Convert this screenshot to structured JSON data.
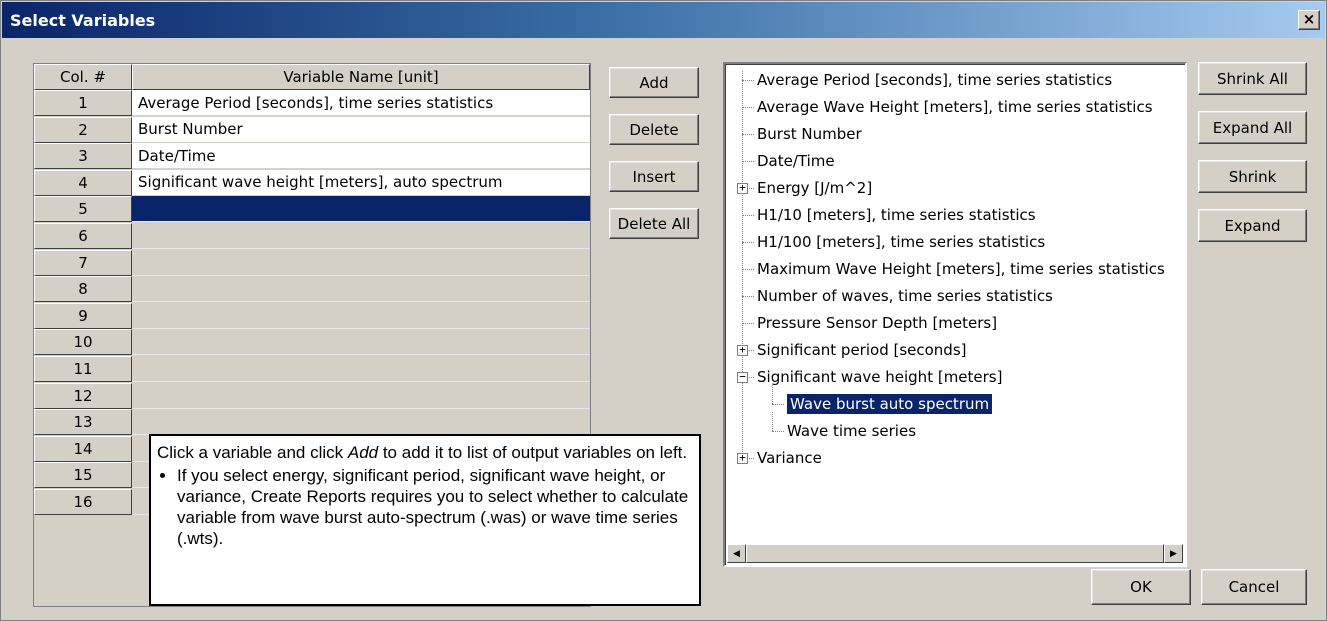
{
  "window": {
    "title": "Select Variables",
    "close_label": "×"
  },
  "grid": {
    "col_header": "Col. #",
    "name_header": "Variable Name [unit]",
    "rows": [
      {
        "num": "1",
        "name": "Average Period [seconds], time series statistics"
      },
      {
        "num": "2",
        "name": "Burst Number"
      },
      {
        "num": "3",
        "name": "Date/Time"
      },
      {
        "num": "4",
        "name": "Significant wave height [meters], auto spectrum"
      },
      {
        "num": "5",
        "name": ""
      },
      {
        "num": "6",
        "name": ""
      },
      {
        "num": "7",
        "name": ""
      },
      {
        "num": "8",
        "name": ""
      },
      {
        "num": "9",
        "name": ""
      },
      {
        "num": "10",
        "name": ""
      },
      {
        "num": "11",
        "name": ""
      },
      {
        "num": "12",
        "name": ""
      },
      {
        "num": "13",
        "name": ""
      },
      {
        "num": "14",
        "name": ""
      },
      {
        "num": "15",
        "name": ""
      },
      {
        "num": "16",
        "name": ""
      }
    ],
    "selected_row": "5"
  },
  "middle_buttons": {
    "add": "Add",
    "delete": "Delete",
    "insert": "Insert",
    "delete_all": "Delete All"
  },
  "tree": {
    "items": [
      {
        "label": "Average Period [seconds], time series statistics",
        "expander": ""
      },
      {
        "label": "Average Wave Height [meters], time series statistics",
        "expander": ""
      },
      {
        "label": "Burst Number",
        "expander": ""
      },
      {
        "label": "Date/Time",
        "expander": ""
      },
      {
        "label": "Energy [J/m^2]",
        "expander": "+"
      },
      {
        "label": "H1/10 [meters], time series statistics",
        "expander": ""
      },
      {
        "label": "H1/100 [meters], time series statistics",
        "expander": ""
      },
      {
        "label": "Maximum Wave Height [meters], time series statistics",
        "expander": ""
      },
      {
        "label": "Number of waves, time series statistics",
        "expander": ""
      },
      {
        "label": "Pressure Sensor Depth [meters]",
        "expander": ""
      },
      {
        "label": "Significant period [seconds]",
        "expander": "+"
      },
      {
        "label": "Significant wave height [meters]",
        "expander": "−"
      },
      {
        "label": "Wave burst auto spectrum",
        "expander": "",
        "child": true,
        "selected": true
      },
      {
        "label": "Wave time series",
        "expander": "",
        "child": true
      },
      {
        "label": "Variance",
        "expander": "+"
      }
    ]
  },
  "right_buttons": {
    "shrink_all": "Shrink All",
    "expand_all": "Expand All",
    "shrink": "Shrink",
    "expand": "Expand"
  },
  "bottom_buttons": {
    "ok": "OK",
    "cancel": "Cancel"
  },
  "note": {
    "line1_pre": "Click a variable and click ",
    "line1_em": "Add",
    "line1_post": " to add it to list of output variables on left.",
    "bullet": "If you select energy, significant period, significant wave height, or variance, Create Reports requires you to select whether to calculate variable from wave burst auto-spectrum (.was) or wave time series (.wts)."
  },
  "colors": {
    "title_gradient_start": "#0a246a",
    "title_gradient_end": "#a6caf0",
    "selection": "#0a246a",
    "face": "#d4d0c8"
  }
}
